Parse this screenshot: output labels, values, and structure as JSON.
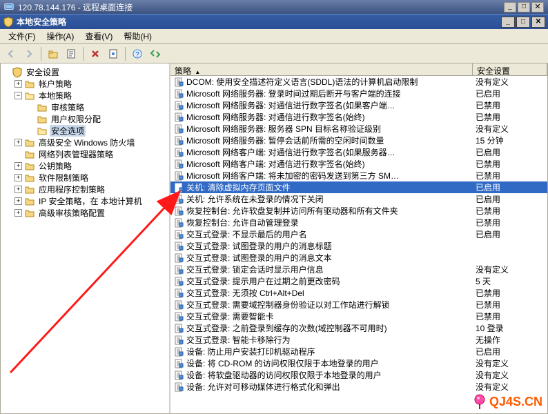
{
  "rdp": {
    "ip": "120.78.144.176",
    "title_suffix": "远程桌面连接"
  },
  "window": {
    "title": "本地安全策略"
  },
  "menu": {
    "file": "文件(F)",
    "action": "操作(A)",
    "view": "查看(V)",
    "help": "帮助(H)"
  },
  "tree": {
    "root": "安全设置",
    "items": [
      {
        "label": "帐户策略",
        "exp": "+"
      },
      {
        "label": "本地策略",
        "exp": "-",
        "children": [
          {
            "label": "审核策略"
          },
          {
            "label": "用户权限分配"
          },
          {
            "label": "安全选项",
            "selected": true
          }
        ]
      },
      {
        "label": "高级安全 Windows 防火墙",
        "exp": "+"
      },
      {
        "label": "网络列表管理器策略",
        "exp": ""
      },
      {
        "label": "公钥策略",
        "exp": "+"
      },
      {
        "label": "软件限制策略",
        "exp": "+"
      },
      {
        "label": "应用程序控制策略",
        "exp": "+"
      },
      {
        "label": "IP 安全策略，在 本地计算机",
        "exp": "+"
      },
      {
        "label": "高级审核策略配置",
        "exp": "+"
      }
    ]
  },
  "list": {
    "columns": {
      "policy": "策略",
      "setting": "安全设置"
    },
    "arrow_label": "▲",
    "rows": [
      {
        "policy": "DCOM: 使用安全描述符定义语言(SDDL)语法的计算机启动限制",
        "setting": "没有定义"
      },
      {
        "policy": "Microsoft 网络服务器: 登录时间过期后断开与客户端的连接",
        "setting": "已启用"
      },
      {
        "policy": "Microsoft 网络服务器: 对通信进行数字签名(如果客户端…",
        "setting": "已禁用"
      },
      {
        "policy": "Microsoft 网络服务器: 对通信进行数字签名(始终)",
        "setting": "已禁用"
      },
      {
        "policy": "Microsoft 网络服务器: 服务器 SPN 目标名称验证级别",
        "setting": "没有定义"
      },
      {
        "policy": "Microsoft 网络服务器: 暂停会话前所需的空闲时间数量",
        "setting": "15 分钟"
      },
      {
        "policy": "Microsoft 网络客户端: 对通信进行数字签名(如果服务器…",
        "setting": "已启用"
      },
      {
        "policy": "Microsoft 网络客户端: 对通信进行数字签名(始终)",
        "setting": "已禁用"
      },
      {
        "policy": "Microsoft 网络客户端: 将未加密的密码发送到第三方 SM…",
        "setting": "已禁用"
      },
      {
        "policy": "关机: 清除虚拟内存页面文件",
        "setting": "已启用",
        "selected": true
      },
      {
        "policy": "关机: 允许系统在未登录的情况下关闭",
        "setting": "已启用"
      },
      {
        "policy": "恢复控制台: 允许软盘复制并访问所有驱动器和所有文件夹",
        "setting": "已禁用"
      },
      {
        "policy": "恢复控制台: 允许自动管理登录",
        "setting": "已禁用"
      },
      {
        "policy": "交互式登录: 不显示最后的用户名",
        "setting": "已启用"
      },
      {
        "policy": "交互式登录: 试图登录的用户的消息标题",
        "setting": ""
      },
      {
        "policy": "交互式登录: 试图登录的用户的消息文本",
        "setting": ""
      },
      {
        "policy": "交互式登录: 锁定会话时显示用户信息",
        "setting": "没有定义"
      },
      {
        "policy": "交互式登录: 提示用户在过期之前更改密码",
        "setting": "5 天"
      },
      {
        "policy": "交互式登录: 无须按 Ctrl+Alt+Del",
        "setting": "已禁用"
      },
      {
        "policy": "交互式登录: 需要域控制器身份验证以对工作站进行解锁",
        "setting": "已禁用"
      },
      {
        "policy": "交互式登录: 需要智能卡",
        "setting": "已禁用"
      },
      {
        "policy": "交互式登录: 之前登录到缓存的次数(域控制器不可用时)",
        "setting": "10 登录"
      },
      {
        "policy": "交互式登录: 智能卡移除行为",
        "setting": "无操作"
      },
      {
        "policy": "设备: 防止用户安装打印机驱动程序",
        "setting": "已启用"
      },
      {
        "policy": "设备: 将 CD-ROM 的访问权限仅限于本地登录的用户",
        "setting": "没有定义"
      },
      {
        "policy": "设备: 将软盘驱动器的访问权限仅限于本地登录的用户",
        "setting": "没有定义"
      },
      {
        "policy": "设备: 允许对可移动媒体进行格式化和弹出",
        "setting": "没有定义"
      }
    ]
  },
  "watermark": {
    "text": "QJ4S.CN"
  }
}
